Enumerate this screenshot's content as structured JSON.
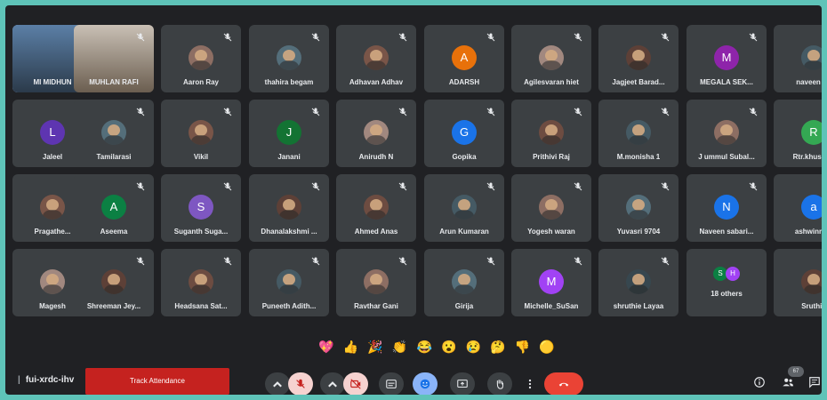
{
  "meeting": {
    "code": "fui-xrdc-ihv",
    "attendance_label": "Track Attendance",
    "participant_count": "67",
    "others_label": "18 others"
  },
  "participants": [
    [
      "MI MIDHUN",
      "MUHLAN RAFI",
      "Aaron Ray",
      "thahira begam",
      "Adhavan Adhav",
      "ADARSH",
      "Agilesvaran hiet",
      "Jagjeet Barad...",
      "MEGALA SEK...",
      "naveen raj"
    ],
    [
      "Jaleel",
      "Tamilarasi",
      "Vikil",
      "Janani",
      "Anirudh N",
      "Gopika",
      "Prithivi Raj",
      "M.monisha 1",
      "J ummul Subal...",
      "Rtr.khushbu"
    ],
    [
      "Pragathe...",
      "Aseema",
      "Suganth Suga...",
      "Dhanalakshmi ...",
      "Ahmed Anas",
      "Arun Kumaran",
      "Yogesh waran",
      "Yuvasri 9704",
      "Naveen sabari...",
      "ashwinrath"
    ],
    [
      "Magesh",
      "Shreeman Jey...",
      "Headsana Sat...",
      "Puneeth Adith...",
      "Ravthar Gani",
      "Girija",
      "Michelle_SuSan",
      "shruthie Layaa",
      "18 others",
      "Sruthili"
    ]
  ],
  "avatar_letters": {
    "ADARSH": "A",
    "MEGALA SEK...": "M",
    "Jaleel": "L",
    "Janani": "J",
    "Gopika": "G",
    "Rtr.khushbu": "R",
    "Aseema": "A",
    "Suganth Suga...": "S",
    "Naveen sabari...": "N",
    "ashwinrath": "a",
    "Michelle_SuSan": "M"
  },
  "avatar_colors": {
    "ADARSH": "#e8710a",
    "MEGALA SEK...": "#8e24aa",
    "Jaleel": "#5e35b1",
    "Janani": "#137333",
    "Gopika": "#1a73e8",
    "Rtr.khushbu": "#34a853",
    "Aseema": "#0b8043",
    "Suganth Suga...": "#7e57c2",
    "Naveen sabari...": "#1a73e8",
    "ashwinrath": "#1a73e8",
    "Michelle_SuSan": "#a142f4"
  },
  "others_mini": [
    {
      "letter": "S",
      "color": "#0b8043"
    },
    {
      "letter": "H",
      "color": "#a142f4"
    }
  ],
  "reactions": [
    "💖",
    "👍",
    "🎉",
    "👏",
    "😂",
    "😮",
    "😢",
    "🤔",
    "👎",
    "🟡"
  ],
  "icons": {
    "mic_off": "mic-off-icon",
    "cam_off": "camera-off-icon",
    "captions": "captions-icon",
    "emoji": "emoji-icon",
    "present": "present-icon",
    "raise_hand": "raise-hand-icon",
    "more": "more-options-icon",
    "end_call": "end-call-icon",
    "info": "info-icon",
    "people": "people-icon",
    "chat": "chat-icon"
  },
  "colors": {
    "background": "#202124",
    "tile": "#3c4043",
    "end_call": "#ea4335",
    "attendance": "#c5221f",
    "accent": "#8ab4f8"
  }
}
